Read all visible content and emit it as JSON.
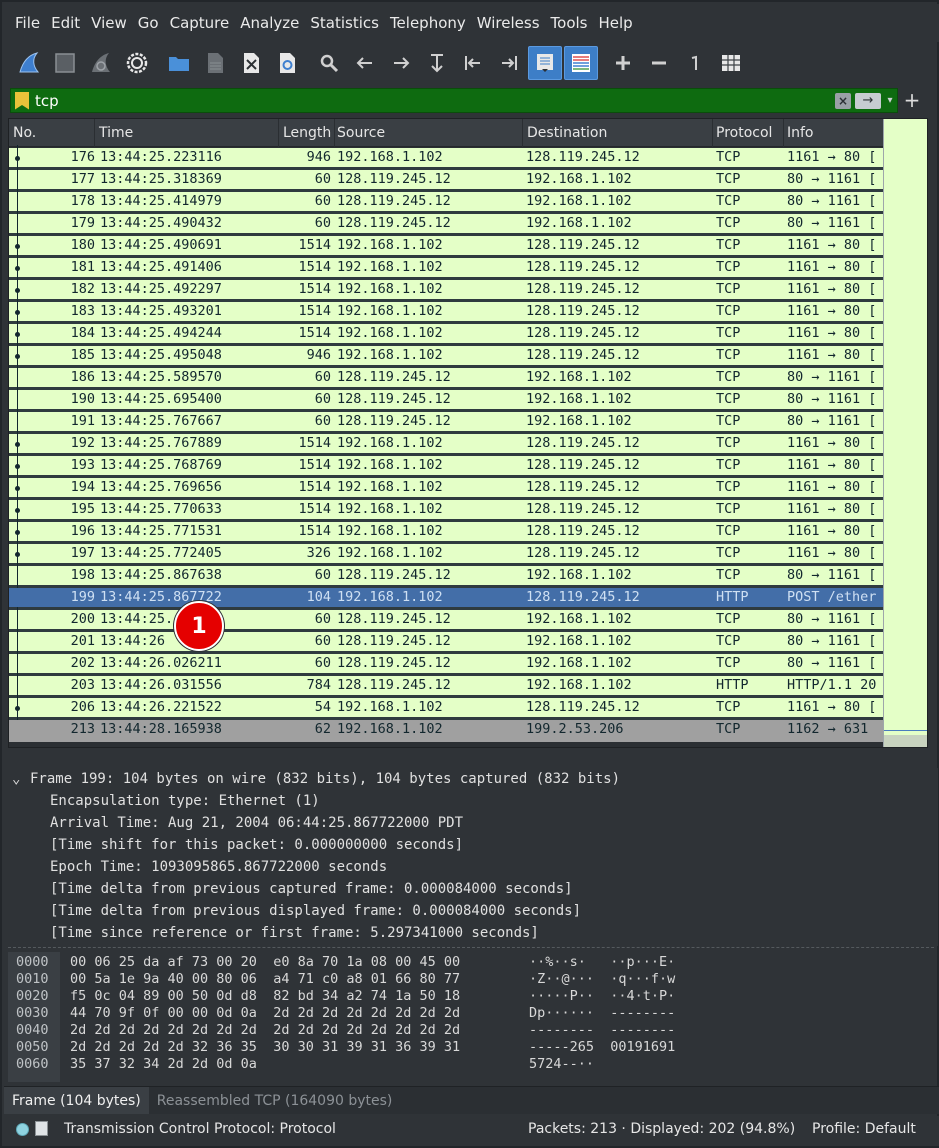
{
  "menubar": {
    "items": [
      "File",
      "Edit",
      "View",
      "Go",
      "Capture",
      "Analyze",
      "Statistics",
      "Telephony",
      "Wireless",
      "Tools",
      "Help"
    ]
  },
  "toolbar": {
    "buttons": [
      {
        "name": "shark-fin-start-icon"
      },
      {
        "name": "stop-square-icon"
      },
      {
        "name": "restart-fin-icon"
      },
      {
        "name": "capture-options-gear-icon"
      },
      {
        "name": "open-folder-icon"
      },
      {
        "name": "save-file-icon"
      },
      {
        "name": "close-file-icon"
      },
      {
        "name": "reload-file-icon"
      },
      {
        "name": "find-magnifier-icon"
      },
      {
        "name": "go-back-arrow-icon"
      },
      {
        "name": "go-forward-arrow-icon"
      },
      {
        "name": "go-to-packet-icon"
      },
      {
        "name": "first-packet-icon"
      },
      {
        "name": "last-packet-icon"
      },
      {
        "name": "autoscroll-icon"
      },
      {
        "name": "colorize-icon"
      },
      {
        "name": "zoom-in-icon"
      },
      {
        "name": "zoom-out-icon"
      },
      {
        "name": "normal-size-icon"
      },
      {
        "name": "resize-columns-icon"
      }
    ]
  },
  "filter": {
    "value": "tcp",
    "clear_label": "×",
    "apply_label": "→",
    "add_label": "+"
  },
  "columns": {
    "no": "No.",
    "time": "Time",
    "length": "Length",
    "source": "Source",
    "destination": "Destination",
    "protocol": "Protocol",
    "info": "Info"
  },
  "packets": [
    {
      "no": "176",
      "time": "13:44:25.223116",
      "len": "946",
      "src": "192.168.1.102",
      "dst": "128.119.245.12",
      "proto": "TCP",
      "info": "1161 → 80 ["
    },
    {
      "no": "177",
      "time": "13:44:25.318369",
      "len": "60",
      "src": "128.119.245.12",
      "dst": "192.168.1.102",
      "proto": "TCP",
      "info": "80 → 1161 ["
    },
    {
      "no": "178",
      "time": "13:44:25.414979",
      "len": "60",
      "src": "128.119.245.12",
      "dst": "192.168.1.102",
      "proto": "TCP",
      "info": "80 → 1161 ["
    },
    {
      "no": "179",
      "time": "13:44:25.490432",
      "len": "60",
      "src": "128.119.245.12",
      "dst": "192.168.1.102",
      "proto": "TCP",
      "info": "80 → 1161 ["
    },
    {
      "no": "180",
      "time": "13:44:25.490691",
      "len": "1514",
      "src": "192.168.1.102",
      "dst": "128.119.245.12",
      "proto": "TCP",
      "info": "1161 → 80 ["
    },
    {
      "no": "181",
      "time": "13:44:25.491406",
      "len": "1514",
      "src": "192.168.1.102",
      "dst": "128.119.245.12",
      "proto": "TCP",
      "info": "1161 → 80 ["
    },
    {
      "no": "182",
      "time": "13:44:25.492297",
      "len": "1514",
      "src": "192.168.1.102",
      "dst": "128.119.245.12",
      "proto": "TCP",
      "info": "1161 → 80 ["
    },
    {
      "no": "183",
      "time": "13:44:25.493201",
      "len": "1514",
      "src": "192.168.1.102",
      "dst": "128.119.245.12",
      "proto": "TCP",
      "info": "1161 → 80 ["
    },
    {
      "no": "184",
      "time": "13:44:25.494244",
      "len": "1514",
      "src": "192.168.1.102",
      "dst": "128.119.245.12",
      "proto": "TCP",
      "info": "1161 → 80 ["
    },
    {
      "no": "185",
      "time": "13:44:25.495048",
      "len": "946",
      "src": "192.168.1.102",
      "dst": "128.119.245.12",
      "proto": "TCP",
      "info": "1161 → 80 ["
    },
    {
      "no": "186",
      "time": "13:44:25.589570",
      "len": "60",
      "src": "128.119.245.12",
      "dst": "192.168.1.102",
      "proto": "TCP",
      "info": "80 → 1161 ["
    },
    {
      "no": "190",
      "time": "13:44:25.695400",
      "len": "60",
      "src": "128.119.245.12",
      "dst": "192.168.1.102",
      "proto": "TCP",
      "info": "80 → 1161 ["
    },
    {
      "no": "191",
      "time": "13:44:25.767667",
      "len": "60",
      "src": "128.119.245.12",
      "dst": "192.168.1.102",
      "proto": "TCP",
      "info": "80 → 1161 ["
    },
    {
      "no": "192",
      "time": "13:44:25.767889",
      "len": "1514",
      "src": "192.168.1.102",
      "dst": "128.119.245.12",
      "proto": "TCP",
      "info": "1161 → 80 ["
    },
    {
      "no": "193",
      "time": "13:44:25.768769",
      "len": "1514",
      "src": "192.168.1.102",
      "dst": "128.119.245.12",
      "proto": "TCP",
      "info": "1161 → 80 ["
    },
    {
      "no": "194",
      "time": "13:44:25.769656",
      "len": "1514",
      "src": "192.168.1.102",
      "dst": "128.119.245.12",
      "proto": "TCP",
      "info": "1161 → 80 ["
    },
    {
      "no": "195",
      "time": "13:44:25.770633",
      "len": "1514",
      "src": "192.168.1.102",
      "dst": "128.119.245.12",
      "proto": "TCP",
      "info": "1161 → 80 ["
    },
    {
      "no": "196",
      "time": "13:44:25.771531",
      "len": "1514",
      "src": "192.168.1.102",
      "dst": "128.119.245.12",
      "proto": "TCP",
      "info": "1161 → 80 ["
    },
    {
      "no": "197",
      "time": "13:44:25.772405",
      "len": "326",
      "src": "192.168.1.102",
      "dst": "128.119.245.12",
      "proto": "TCP",
      "info": "1161 → 80 ["
    },
    {
      "no": "198",
      "time": "13:44:25.867638",
      "len": "60",
      "src": "128.119.245.12",
      "dst": "192.168.1.102",
      "proto": "TCP",
      "info": "80 → 1161 ["
    },
    {
      "no": "199",
      "time": "13:44:25.867722",
      "len": "104",
      "src": "192.168.1.102",
      "dst": "128.119.245.12",
      "proto": "HTTP",
      "info": "POST /ether",
      "selected": true
    },
    {
      "no": "200",
      "time": "13:44:25.     2",
      "len": "60",
      "src": "128.119.245.12",
      "dst": "192.168.1.102",
      "proto": "TCP",
      "info": "80 → 1161 ["
    },
    {
      "no": "201",
      "time": "13:44:26     8",
      "len": "60",
      "src": "128.119.245.12",
      "dst": "192.168.1.102",
      "proto": "TCP",
      "info": "80 → 1161 ["
    },
    {
      "no": "202",
      "time": "13:44:26.026211",
      "len": "60",
      "src": "128.119.245.12",
      "dst": "192.168.1.102",
      "proto": "TCP",
      "info": "80 → 1161 ["
    },
    {
      "no": "203",
      "time": "13:44:26.031556",
      "len": "784",
      "src": "128.119.245.12",
      "dst": "192.168.1.102",
      "proto": "HTTP",
      "info": "HTTP/1.1 20"
    },
    {
      "no": "206",
      "time": "13:44:26.221522",
      "len": "54",
      "src": "192.168.1.102",
      "dst": "128.119.245.12",
      "proto": "TCP",
      "info": "1161 → 80 ["
    },
    {
      "no": "213",
      "time": "13:44:28.165938",
      "len": "62",
      "src": "192.168.1.102",
      "dst": "199.2.53.206",
      "proto": "TCP",
      "info": "1162 → 631 ",
      "gray": true
    }
  ],
  "badge": {
    "label": "1"
  },
  "details": {
    "frame_line": "Frame 199: 104 bytes on wire (832 bits), 104 bytes captured (832 bits)",
    "lines": [
      "Encapsulation type: Ethernet (1)",
      "Arrival Time: Aug 21, 2004 06:44:25.867722000 PDT",
      "[Time shift for this packet: 0.000000000 seconds]",
      "Epoch Time: 1093095865.867722000 seconds",
      "[Time delta from previous captured frame: 0.000084000 seconds]",
      "[Time delta from previous displayed frame: 0.000084000 seconds]",
      "[Time since reference or first frame: 5.297341000 seconds]"
    ]
  },
  "hex": [
    {
      "off": "0000",
      "bytes": "00 06 25 da af 73 00 20  e0 8a 70 1a 08 00 45 00",
      "ascii": "··%··s·   ··p···E·"
    },
    {
      "off": "0010",
      "bytes": "00 5a 1e 9a 40 00 80 06  a4 71 c0 a8 01 66 80 77",
      "ascii": "·Z··@···  ·q···f·w"
    },
    {
      "off": "0020",
      "bytes": "f5 0c 04 89 00 50 0d d8  82 bd 34 a2 74 1a 50 18",
      "ascii": "·····P··  ··4·t·P·"
    },
    {
      "off": "0030",
      "bytes": "44 70 9f 0f 00 00 0d 0a  2d 2d 2d 2d 2d 2d 2d 2d",
      "ascii": "Dp······  --------"
    },
    {
      "off": "0040",
      "bytes": "2d 2d 2d 2d 2d 2d 2d 2d  2d 2d 2d 2d 2d 2d 2d 2d",
      "ascii": "--------  --------"
    },
    {
      "off": "0050",
      "bytes": "2d 2d 2d 2d 2d 32 36 35  30 30 31 39 31 36 39 31",
      "ascii": "-----265  00191691"
    },
    {
      "off": "0060",
      "bytes": "35 37 32 34 2d 2d 0d 0a",
      "ascii": "5724--··"
    }
  ],
  "bytetabs": {
    "frame": "Frame (104 bytes)",
    "reassembled": "Reassembled TCP (164090 bytes)"
  },
  "status": {
    "protocol": "Transmission Control Protocol: Protocol",
    "packets": "Packets: 213 · Displayed: 202 (94.8%)",
    "profile": "Profile: Default"
  }
}
